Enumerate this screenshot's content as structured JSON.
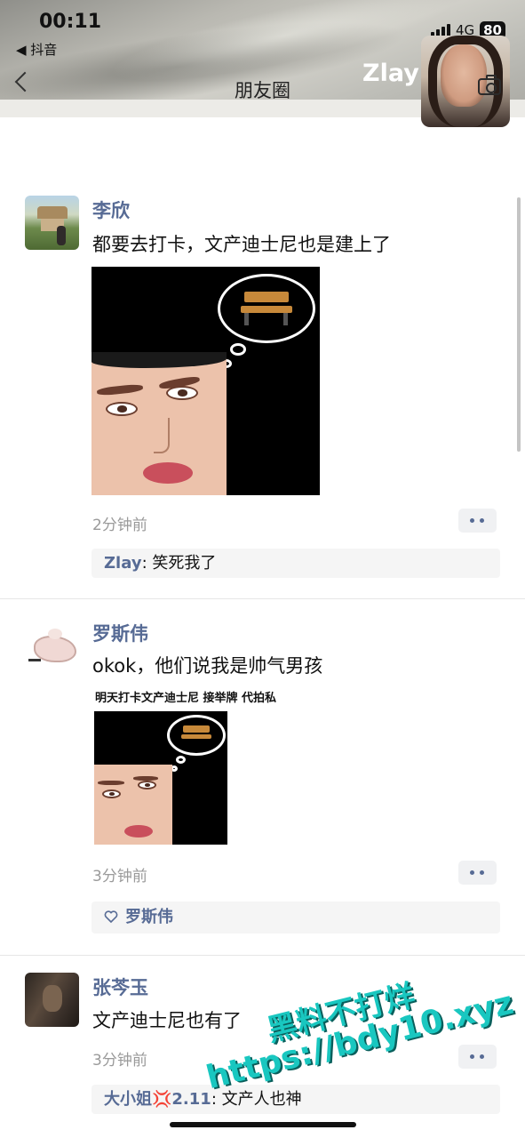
{
  "status_bar": {
    "time": "00:11",
    "back_app": "◀ 抖音",
    "network": "4G",
    "battery": "80"
  },
  "nav": {
    "title": "朋友圈",
    "profile_name": "Zlay"
  },
  "posts": [
    {
      "author": "李欣",
      "text": "都要去打卡，文产迪士尼也是建上了",
      "time": "2分钟前",
      "comment": {
        "name": "Zlay",
        "text": ": 笑死我了"
      }
    },
    {
      "author": "罗斯伟",
      "text": "okok，他们说我是帅气男孩",
      "image_caption": "明天打卡文产迪士尼 接举牌 代拍私",
      "time": "3分钟前",
      "like": "罗斯伟"
    },
    {
      "author": "张芩玉",
      "text": "文产迪士尼也有了",
      "time": "3分钟前",
      "comment": {
        "name": "大小姐💢2.11",
        "text": ": 文产人也神"
      }
    }
  ],
  "watermark": {
    "line1": "黑料不打烊",
    "line2": "https://bdy10.xyz"
  },
  "colors": {
    "link_blue": "#576b95",
    "watermark_teal": "#19c7c0"
  }
}
